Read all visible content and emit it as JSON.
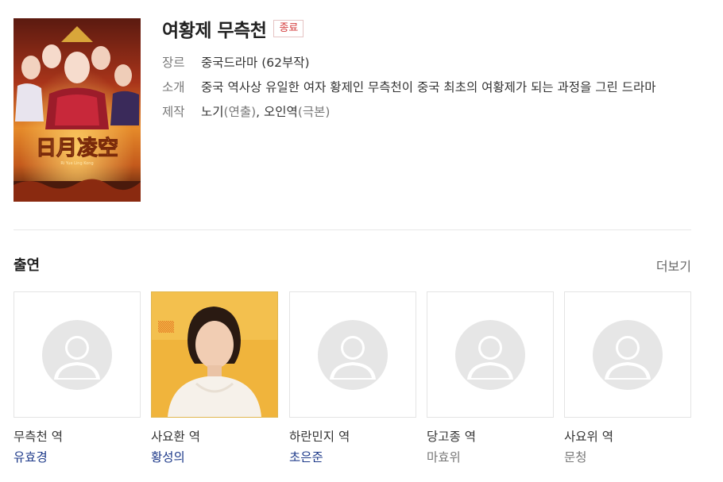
{
  "drama": {
    "title": "여황제 무측천",
    "status": "종료",
    "poster_text": "日月凌空",
    "poster_subtext": "Ri Yue Ling Kong"
  },
  "meta": {
    "genre_label": "장르",
    "genre_value": "중국드라마 (62부작)",
    "intro_label": "소개",
    "intro_value": "중국 역사상 유일한 여자 황제인 무측천이 중국 최초의 여황제가 되는 과정을 그린 드라마",
    "production_label": "제작",
    "production_director": "노기",
    "production_director_role": "(연출)",
    "production_separator": ",",
    "production_writer": "오인역",
    "production_writer_role": "(극본)"
  },
  "cast_section": {
    "title": "출연",
    "more_label": "더보기"
  },
  "cast": [
    {
      "role": "무측천 역",
      "actor": "유효경",
      "linked": true,
      "photo": false
    },
    {
      "role": "사요환 역",
      "actor": "황성의",
      "linked": true,
      "photo": true
    },
    {
      "role": "하란민지 역",
      "actor": "초은준",
      "linked": true,
      "photo": false
    },
    {
      "role": "당고종 역",
      "actor": "마효위",
      "linked": false,
      "photo": false
    },
    {
      "role": "사요위 역",
      "actor": "문청",
      "linked": false,
      "photo": false
    }
  ],
  "colors": {
    "badge": "#d33a3a",
    "actor_link": "#1e3a8a",
    "placeholder": "#e6e6e6"
  }
}
